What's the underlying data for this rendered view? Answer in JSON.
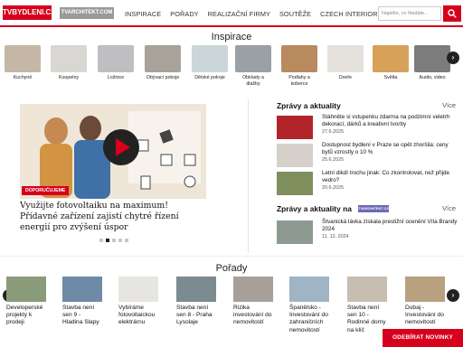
{
  "header": {
    "logo_primary": "TVBYDLENI.CZ",
    "logo_secondary": "TVARCHITEKT.COM",
    "nav": [
      "INSPIRACE",
      "POŘADY",
      "REALIZAČNÍ FIRMY",
      "SOUTĚŽE",
      "CZECH INTERIOR AWARD"
    ],
    "search_placeholder": "Napište, co hledáte..."
  },
  "inspirace": {
    "title": "Inspirace",
    "categories": [
      {
        "label": "Kuchyně",
        "color": "#c5b7a6"
      },
      {
        "label": "Koupelny",
        "color": "#d9d7d3"
      },
      {
        "label": "Ložnice",
        "color": "#bfbfc2"
      },
      {
        "label": "Obývací pokoje",
        "color": "#a8a39a"
      },
      {
        "label": "Dětské pokoje",
        "color": "#cbd6d8"
      },
      {
        "label": "Obklady a dlažby",
        "color": "#9aa0a5"
      },
      {
        "label": "Podlahy a koberce",
        "color": "#b98a5e"
      },
      {
        "label": "Dveře",
        "color": "#e4e1dc"
      },
      {
        "label": "Světla",
        "color": "#d8a15a"
      },
      {
        "label": "Audio, video",
        "color": "#7c7c7c"
      }
    ]
  },
  "hero": {
    "badge": "DOPORUČUJEME",
    "title": "Využijte fotovoltaiku na maximum! Přídavné zařízení zajistí chytré řízení energií pro zvýšení úspor",
    "slide_count": 5,
    "active_slide": 2,
    "accent": "#d6001c"
  },
  "news": {
    "heading": "Zprávy a aktuality",
    "more": "Více",
    "items": [
      {
        "text": "Stáhněte si vstupenku zdarma na podzimní veletrh dekorací, dárků a kreativní tvorby",
        "date": "27.6.2025",
        "color": "#b2242a"
      },
      {
        "text": "Dostupnost bydlení v Praze se opět zhoršila: ceny bytů vzrostly o 10 %",
        "date": "25.6.2025",
        "color": "#d5d0ca"
      },
      {
        "text": "Letní dikdí trochu jinak: Co zkontrolovat, než přijde vedro?",
        "date": "20.6.2025",
        "color": "#7f8f5e"
      }
    ]
  },
  "news2": {
    "heading": "Zprávy a aktuality na",
    "partner": "TVARCHITEKT.COM",
    "more": "Více",
    "items": [
      {
        "text": "Štvanická lávka získala prestižní ocenění Víta Brandy 2024",
        "date": "11. 12. 2024",
        "color": "#8d9a92"
      }
    ]
  },
  "porady": {
    "title": "Pořady",
    "shows": [
      {
        "label": "Developerské projekty k prodeji",
        "color": "#8a9b7a"
      },
      {
        "label": "Stavba není sen 9 - Hladina Slapy",
        "color": "#6f8aa7"
      },
      {
        "label": "Vybíráme fotovoltaickou elektrárnu",
        "color": "#e7e5e1"
      },
      {
        "label": "Stavba není sen 8 - Praha Lysolaje",
        "color": "#7c8b91"
      },
      {
        "label": "Rizika investování do nemovitostí",
        "color": "#a8a098"
      },
      {
        "label": "Španělsko - Investování do zahraničních nemovitostí",
        "color": "#9fb4c4"
      },
      {
        "label": "Stavba není sen 10 - Rodinné domy na klíč",
        "color": "#c7beb1"
      },
      {
        "label": "Dubaj - Investování do nemovitostí",
        "color": "#b9a07e"
      }
    ]
  },
  "footer": {
    "newsletter_button": "ODEBÍRAT NOVINKY"
  }
}
